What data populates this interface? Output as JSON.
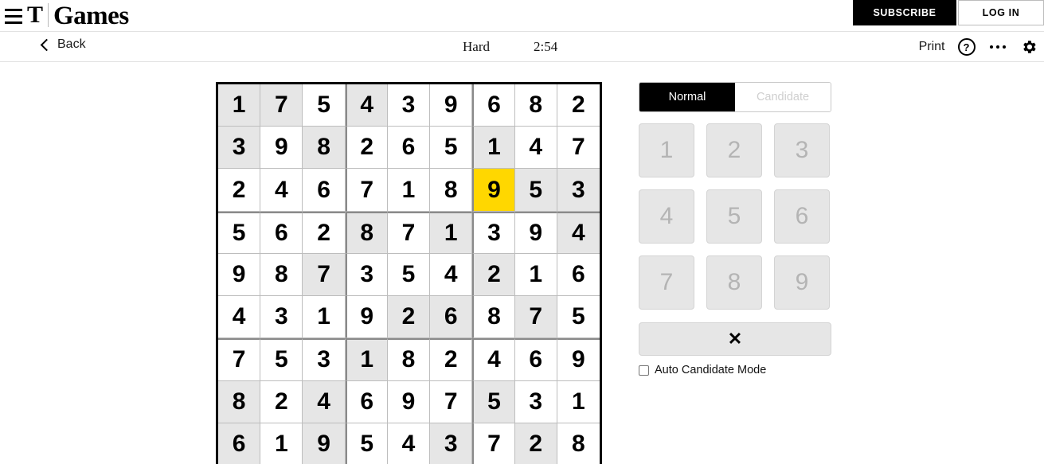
{
  "masthead": {
    "menu_icon": "hamburger-icon",
    "brand_t": "T",
    "brand_name": "Games",
    "subscribe_label": "SUBSCRIBE",
    "login_label": "LOG IN"
  },
  "toolbar": {
    "back_icon": "chevron-left-icon",
    "back_label": "Back",
    "difficulty": "Hard",
    "timer": "2:54",
    "print_label": "Print",
    "help_icon": "question-mark-circle-icon",
    "help_glyph": "?",
    "more_icon": "ellipsis-icon",
    "settings_icon": "gear-icon"
  },
  "board": {
    "rows": [
      [
        {
          "v": "1",
          "g": true
        },
        {
          "v": "7",
          "g": true
        },
        {
          "v": "5",
          "g": false
        },
        {
          "v": "4",
          "g": true
        },
        {
          "v": "3",
          "g": false
        },
        {
          "v": "9",
          "g": false
        },
        {
          "v": "6",
          "g": false
        },
        {
          "v": "8",
          "g": false
        },
        {
          "v": "2",
          "g": false
        }
      ],
      [
        {
          "v": "3",
          "g": true
        },
        {
          "v": "9",
          "g": false
        },
        {
          "v": "8",
          "g": true
        },
        {
          "v": "2",
          "g": false
        },
        {
          "v": "6",
          "g": false
        },
        {
          "v": "5",
          "g": false
        },
        {
          "v": "1",
          "g": true
        },
        {
          "v": "4",
          "g": false
        },
        {
          "v": "7",
          "g": false
        }
      ],
      [
        {
          "v": "2",
          "g": false
        },
        {
          "v": "4",
          "g": false
        },
        {
          "v": "6",
          "g": false
        },
        {
          "v": "7",
          "g": false
        },
        {
          "v": "1",
          "g": false
        },
        {
          "v": "8",
          "g": false
        },
        {
          "v": "9",
          "g": false,
          "sel": true
        },
        {
          "v": "5",
          "g": true
        },
        {
          "v": "3",
          "g": true
        }
      ],
      [
        {
          "v": "5",
          "g": false
        },
        {
          "v": "6",
          "g": false
        },
        {
          "v": "2",
          "g": false
        },
        {
          "v": "8",
          "g": true
        },
        {
          "v": "7",
          "g": false
        },
        {
          "v": "1",
          "g": true
        },
        {
          "v": "3",
          "g": false
        },
        {
          "v": "9",
          "g": false
        },
        {
          "v": "4",
          "g": true
        }
      ],
      [
        {
          "v": "9",
          "g": false
        },
        {
          "v": "8",
          "g": false
        },
        {
          "v": "7",
          "g": true
        },
        {
          "v": "3",
          "g": false
        },
        {
          "v": "5",
          "g": false
        },
        {
          "v": "4",
          "g": false
        },
        {
          "v": "2",
          "g": true
        },
        {
          "v": "1",
          "g": false
        },
        {
          "v": "6",
          "g": false
        }
      ],
      [
        {
          "v": "4",
          "g": false
        },
        {
          "v": "3",
          "g": false
        },
        {
          "v": "1",
          "g": false
        },
        {
          "v": "9",
          "g": false
        },
        {
          "v": "2",
          "g": true
        },
        {
          "v": "6",
          "g": true
        },
        {
          "v": "8",
          "g": false
        },
        {
          "v": "7",
          "g": true
        },
        {
          "v": "5",
          "g": false
        }
      ],
      [
        {
          "v": "7",
          "g": false
        },
        {
          "v": "5",
          "g": false
        },
        {
          "v": "3",
          "g": false
        },
        {
          "v": "1",
          "g": true
        },
        {
          "v": "8",
          "g": false
        },
        {
          "v": "2",
          "g": false
        },
        {
          "v": "4",
          "g": false
        },
        {
          "v": "6",
          "g": false
        },
        {
          "v": "9",
          "g": false
        }
      ],
      [
        {
          "v": "8",
          "g": true
        },
        {
          "v": "2",
          "g": false
        },
        {
          "v": "4",
          "g": true
        },
        {
          "v": "6",
          "g": false
        },
        {
          "v": "9",
          "g": false
        },
        {
          "v": "7",
          "g": false
        },
        {
          "v": "5",
          "g": true
        },
        {
          "v": "3",
          "g": false
        },
        {
          "v": "1",
          "g": false
        }
      ],
      [
        {
          "v": "6",
          "g": true
        },
        {
          "v": "1",
          "g": false
        },
        {
          "v": "9",
          "g": true
        },
        {
          "v": "5",
          "g": false
        },
        {
          "v": "4",
          "g": false
        },
        {
          "v": "3",
          "g": true
        },
        {
          "v": "7",
          "g": false
        },
        {
          "v": "2",
          "g": true
        },
        {
          "v": "8",
          "g": false
        }
      ]
    ],
    "selected_cell": {
      "row": 3,
      "col": 7,
      "value": "9"
    },
    "colors": {
      "given_cell": "#e6e6e6",
      "empty_cell": "#ffffff",
      "selected_cell": "#ffd700",
      "grid_line": "#bdbdbd",
      "block_line": "#8a8a8a",
      "border": "#000000"
    }
  },
  "controls": {
    "mode_normal": "Normal",
    "mode_candidate": "Candidate",
    "active_mode": "Normal",
    "numbers": [
      "1",
      "2",
      "3",
      "4",
      "5",
      "6",
      "7",
      "8",
      "9"
    ],
    "erase_label": "✕",
    "erase_icon": "x-close-icon",
    "auto_candidate_label": "Auto Candidate Mode",
    "auto_candidate_checked": false
  }
}
